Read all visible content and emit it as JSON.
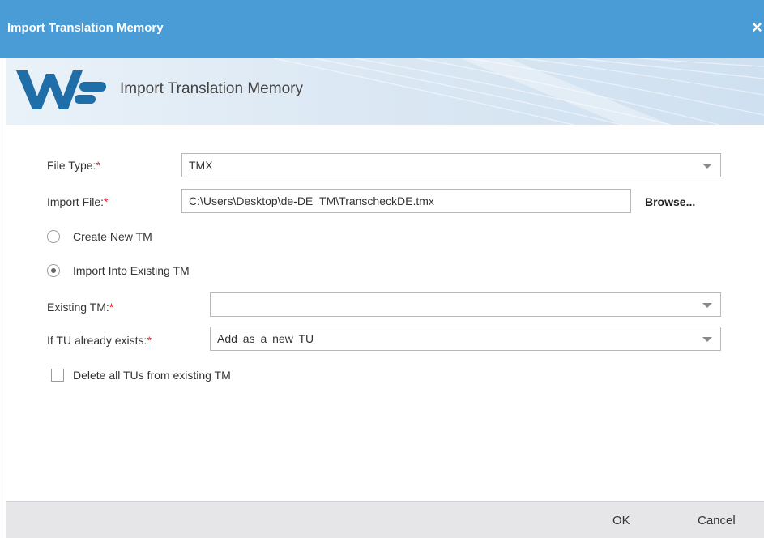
{
  "dialog": {
    "title": "Import Translation Memory",
    "close_glyph": "×",
    "banner_title": "Import Translation Memory",
    "logo_icon": "wordfast-logo-icon"
  },
  "form": {
    "file_type": {
      "label": "File Type:",
      "required_mark": "*",
      "value": "TMX"
    },
    "import_file": {
      "label": "Import File:",
      "required_mark": "*",
      "value": "C:\\Users\\Desktop\\de-DE_TM\\TranscheckDE.tmx",
      "browse_label": "Browse..."
    },
    "create_new_tm": {
      "label": "Create New TM",
      "selected": false
    },
    "import_existing_tm": {
      "label": "Import Into Existing TM",
      "selected": true
    },
    "existing_tm": {
      "label": "Existing TM:",
      "required_mark": "*",
      "value": ""
    },
    "if_tu_exists": {
      "label": "If TU already exists:",
      "required_mark": "*",
      "value": "Add as a new TU"
    },
    "delete_all_tus": {
      "label": "Delete all TUs from existing TM",
      "checked": false
    }
  },
  "footer": {
    "ok_label": "OK",
    "cancel_label": "Cancel"
  },
  "colors": {
    "titlebar": "#4a9cd6",
    "logo": "#1f6ea8",
    "required": "#d9262b"
  }
}
